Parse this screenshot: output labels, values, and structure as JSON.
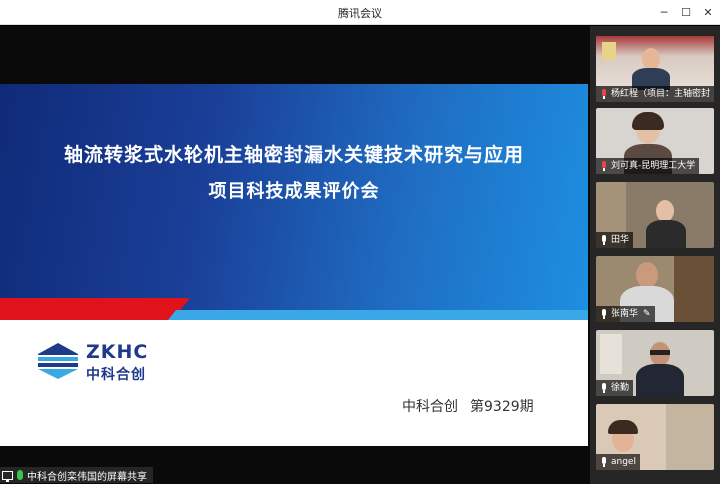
{
  "window": {
    "title": "腾讯会议"
  },
  "slide": {
    "title_line1": "轴流转浆式水轮机主轴密封漏水关键技术研究与应用",
    "title_line2": "项目科技成果评价会",
    "logo_en": "ZKHC",
    "logo_cn": "中科合创",
    "org": "中科合创",
    "issue": "第9329期",
    "colors": {
      "header_start": "#0f2a78",
      "header_end": "#1d8fe0",
      "red": "#e0121b",
      "accent_blue": "#3aa7e6"
    }
  },
  "participants": [
    {
      "name": "杨红程（项目：主轴密封",
      "mic": "muted"
    },
    {
      "name": "刘可真-昆明理工大学",
      "mic": "muted"
    },
    {
      "name": "田华",
      "mic": "on"
    },
    {
      "name": "张南华",
      "mic": "on",
      "editing": true
    },
    {
      "name": "徐勤",
      "mic": "on"
    },
    {
      "name": "angel",
      "mic": "on"
    }
  ],
  "status": {
    "share_label": "中科合创栾伟国的屏幕共享"
  }
}
